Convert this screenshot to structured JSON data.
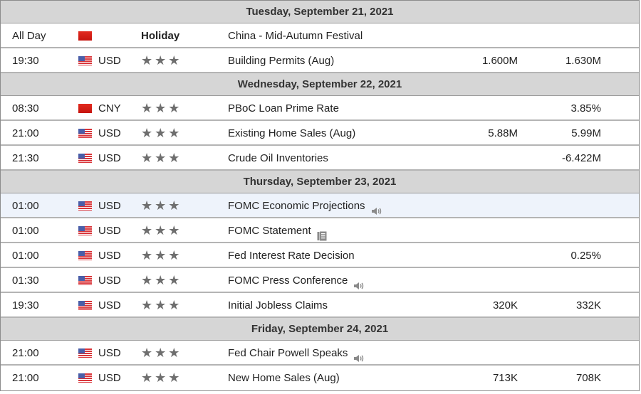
{
  "calendar": {
    "days": [
      {
        "header": "Tuesday, September 21, 2021",
        "events": [
          {
            "time": "All Day",
            "flag": "cn",
            "currency": "",
            "importance_label": "Holiday",
            "stars": "",
            "event": "China - Mid-Autumn Festival",
            "icon": "",
            "actual": "",
            "forecast": "",
            "highlight": false
          },
          {
            "time": "19:30",
            "flag": "us",
            "currency": "USD",
            "importance_label": "",
            "stars": "★★★",
            "event": "Building Permits (Aug)",
            "icon": "",
            "actual": "1.600M",
            "forecast": "1.630M",
            "highlight": false
          }
        ]
      },
      {
        "header": "Wednesday, September 22, 2021",
        "events": [
          {
            "time": "08:30",
            "flag": "cn",
            "currency": "CNY",
            "importance_label": "",
            "stars": "★★★",
            "event": "PBoC Loan Prime Rate",
            "icon": "",
            "actual": "",
            "forecast": "3.85%",
            "highlight": false
          },
          {
            "time": "21:00",
            "flag": "us",
            "currency": "USD",
            "importance_label": "",
            "stars": "★★★",
            "event": "Existing Home Sales (Aug)",
            "icon": "",
            "actual": "5.88M",
            "forecast": "5.99M",
            "highlight": false
          },
          {
            "time": "21:30",
            "flag": "us",
            "currency": "USD",
            "importance_label": "",
            "stars": "★★★",
            "event": "Crude Oil Inventories",
            "icon": "",
            "actual": "",
            "forecast": "-6.422M",
            "highlight": false
          }
        ]
      },
      {
        "header": "Thursday, September 23, 2021",
        "events": [
          {
            "time": "01:00",
            "flag": "us",
            "currency": "USD",
            "importance_label": "",
            "stars": "★★★",
            "event": "FOMC Economic Projections",
            "icon": "speaker",
            "actual": "",
            "forecast": "",
            "highlight": true
          },
          {
            "time": "01:00",
            "flag": "us",
            "currency": "USD",
            "importance_label": "",
            "stars": "★★★",
            "event": "FOMC Statement",
            "icon": "document",
            "actual": "",
            "forecast": "",
            "highlight": false
          },
          {
            "time": "01:00",
            "flag": "us",
            "currency": "USD",
            "importance_label": "",
            "stars": "★★★",
            "event": "Fed Interest Rate Decision",
            "icon": "",
            "actual": "",
            "forecast": "0.25%",
            "highlight": false
          },
          {
            "time": "01:30",
            "flag": "us",
            "currency": "USD",
            "importance_label": "",
            "stars": "★★★",
            "event": "FOMC Press Conference",
            "icon": "speaker",
            "actual": "",
            "forecast": "",
            "highlight": false
          },
          {
            "time": "19:30",
            "flag": "us",
            "currency": "USD",
            "importance_label": "",
            "stars": "★★★",
            "event": "Initial Jobless Claims",
            "icon": "",
            "actual": "320K",
            "forecast": "332K",
            "highlight": false
          }
        ]
      },
      {
        "header": "Friday, September 24, 2021",
        "events": [
          {
            "time": "21:00",
            "flag": "us",
            "currency": "USD",
            "importance_label": "",
            "stars": "★★★",
            "event": "Fed Chair Powell Speaks",
            "icon": "speaker",
            "actual": "",
            "forecast": "",
            "highlight": false
          },
          {
            "time": "21:00",
            "flag": "us",
            "currency": "USD",
            "importance_label": "",
            "stars": "★★★",
            "event": "New Home Sales (Aug)",
            "icon": "",
            "actual": "713K",
            "forecast": "708K",
            "highlight": false
          }
        ]
      }
    ]
  }
}
